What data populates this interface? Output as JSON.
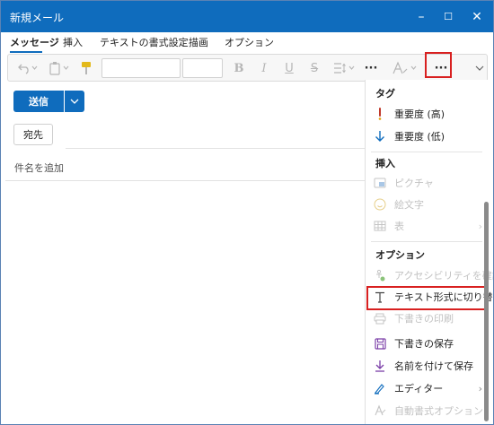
{
  "window": {
    "title": "新規メール",
    "minimize": "–",
    "maximize": "☐",
    "close": "✕"
  },
  "tabs": [
    {
      "label": "メッセージ"
    },
    {
      "label": "挿入"
    },
    {
      "label": "テキストの書式設定"
    },
    {
      "label": "描画"
    },
    {
      "label": "オプション"
    }
  ],
  "toolbar": {
    "undo_icon": "undo-icon",
    "more_label": "···",
    "more_options_label": "···"
  },
  "compose": {
    "send_label": "送信",
    "to_label": "宛先",
    "subject_placeholder": "件名を追加"
  },
  "menu": {
    "sections": [
      {
        "title": "タグ"
      },
      {
        "title": "挿入"
      },
      {
        "title": "オプション"
      }
    ],
    "items": [
      {
        "label": "重要度 (高)",
        "icon": "exclamation-icon"
      },
      {
        "label": "重要度 (低)",
        "icon": "arrow-down-icon"
      },
      {
        "label": "ピクチャ",
        "icon": "picture-icon"
      },
      {
        "label": "絵文字",
        "icon": "emoji-icon"
      },
      {
        "label": "表",
        "icon": "table-icon"
      },
      {
        "label": "アクセシビリティを確認する",
        "icon": "accessibility-icon"
      },
      {
        "label": "テキスト形式に切り替え",
        "icon": "text-format-icon"
      },
      {
        "label": "下書きの印刷",
        "icon": "print-icon"
      },
      {
        "label": "下書きの保存",
        "icon": "save-icon"
      },
      {
        "label": "名前を付けて保存",
        "icon": "save-as-icon"
      },
      {
        "label": "エディター",
        "icon": "editor-icon"
      },
      {
        "label": "自動書式オプション",
        "icon": "auto-format-icon"
      }
    ]
  },
  "colors": {
    "accent": "#0f6cbd",
    "highlight": "#d82020",
    "disabled": "#c2c2c2"
  }
}
